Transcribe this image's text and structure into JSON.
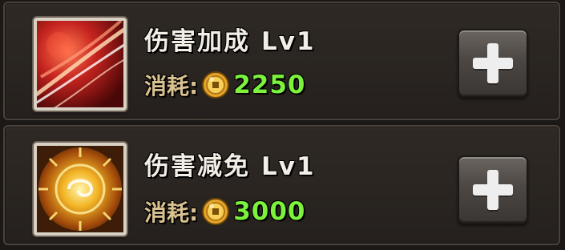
{
  "skills": [
    {
      "name": "伤害加成",
      "level": "Lv1",
      "cost_label": "消耗:",
      "cost_value": "2250",
      "icon": "fire-slash-icon",
      "plus_icon": "plus-icon"
    },
    {
      "name": "伤害减免",
      "level": "Lv1",
      "cost_label": "消耗:",
      "cost_value": "3000",
      "icon": "golden-shield-orb-icon",
      "plus_icon": "plus-icon"
    }
  ],
  "currency_icon": "gold-coin-icon",
  "colors": {
    "cost_value": "#7cf23c",
    "cost_label": "#d9c28f",
    "name": "#f2eee6"
  }
}
